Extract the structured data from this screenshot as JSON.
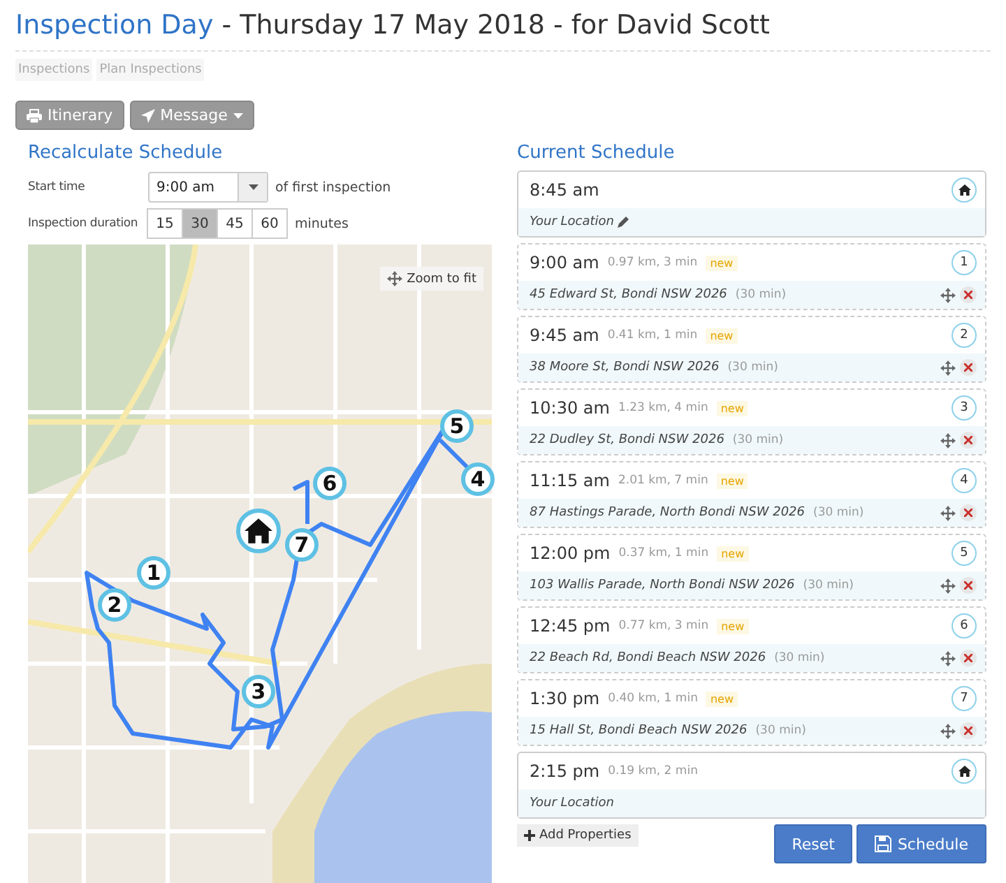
{
  "header": {
    "title_link": "Inspection Day",
    "title_rest": " - Thursday 17 May 2018 - for David Scott"
  },
  "breadcrumbs": [
    {
      "label": "Inspections"
    },
    {
      "label": "Plan Inspections"
    }
  ],
  "toolbar": [
    {
      "kind": "print",
      "label": "Itinerary"
    },
    {
      "kind": "send",
      "label": "Message",
      "dropdown": true
    }
  ],
  "recalculate": {
    "heading": "Recalculate Schedule",
    "start_label": "Start time",
    "start_value": "9:00 am",
    "start_suffix": "of first inspection",
    "duration_label": "Inspection duration",
    "durations": [
      {
        "label": "15",
        "selected": false
      },
      {
        "label": "30",
        "selected": true
      },
      {
        "label": "45",
        "selected": false
      },
      {
        "label": "60",
        "selected": false
      }
    ],
    "duration_suffix": "minutes"
  },
  "map": {
    "zoom_button": "Zoom to fit",
    "markers": [
      {
        "kind": "home"
      },
      {
        "kind": "stop",
        "label": "1"
      },
      {
        "kind": "stop",
        "label": "2"
      },
      {
        "kind": "stop",
        "label": "3"
      },
      {
        "kind": "stop",
        "label": "4"
      },
      {
        "kind": "stop",
        "label": "5"
      },
      {
        "kind": "stop",
        "label": "6"
      },
      {
        "kind": "stop",
        "label": "7"
      }
    ]
  },
  "schedule": {
    "heading": "Current Schedule",
    "items": [
      {
        "kind": "home",
        "time": "8:45 am",
        "address": "Your Location",
        "editable": true
      },
      {
        "kind": "stop",
        "time": "9:00 am",
        "travel": "0.97 km, 3 min",
        "badge": "new",
        "number": "1",
        "address": "45 Edward St, Bondi NSW 2026",
        "duration": "(30 min)"
      },
      {
        "kind": "stop",
        "time": "9:45 am",
        "travel": "0.41 km, 1 min",
        "badge": "new",
        "number": "2",
        "address": "38 Moore St, Bondi NSW 2026",
        "duration": "(30 min)"
      },
      {
        "kind": "stop",
        "time": "10:30 am",
        "travel": "1.23 km, 4 min",
        "badge": "new",
        "number": "3",
        "address": "22 Dudley St, Bondi NSW 2026",
        "duration": "(30 min)"
      },
      {
        "kind": "stop",
        "time": "11:15 am",
        "travel": "2.01 km, 7 min",
        "badge": "new",
        "number": "4",
        "address": "87 Hastings Parade, North Bondi NSW 2026",
        "duration": "(30 min)"
      },
      {
        "kind": "stop",
        "time": "12:00 pm",
        "travel": "0.37 km, 1 min",
        "badge": "new",
        "number": "5",
        "address": "103 Wallis Parade, North Bondi NSW 2026",
        "duration": "(30 min)"
      },
      {
        "kind": "stop",
        "time": "12:45 pm",
        "travel": "0.77 km, 3 min",
        "badge": "new",
        "number": "6",
        "address": "22 Beach Rd, Bondi Beach NSW 2026",
        "duration": "(30 min)"
      },
      {
        "kind": "stop",
        "time": "1:30 pm",
        "travel": "0.40 km, 1 min",
        "badge": "new",
        "number": "7",
        "address": "15 Hall St, Bondi Beach NSW 2026",
        "duration": "(30 min)"
      },
      {
        "kind": "home",
        "time": "2:15 pm",
        "travel": "0.19 km, 2 min",
        "address": "Your Location",
        "editable": false
      }
    ],
    "add_button": "Add Properties",
    "reset_button": "Reset",
    "save_button": "Schedule"
  }
}
